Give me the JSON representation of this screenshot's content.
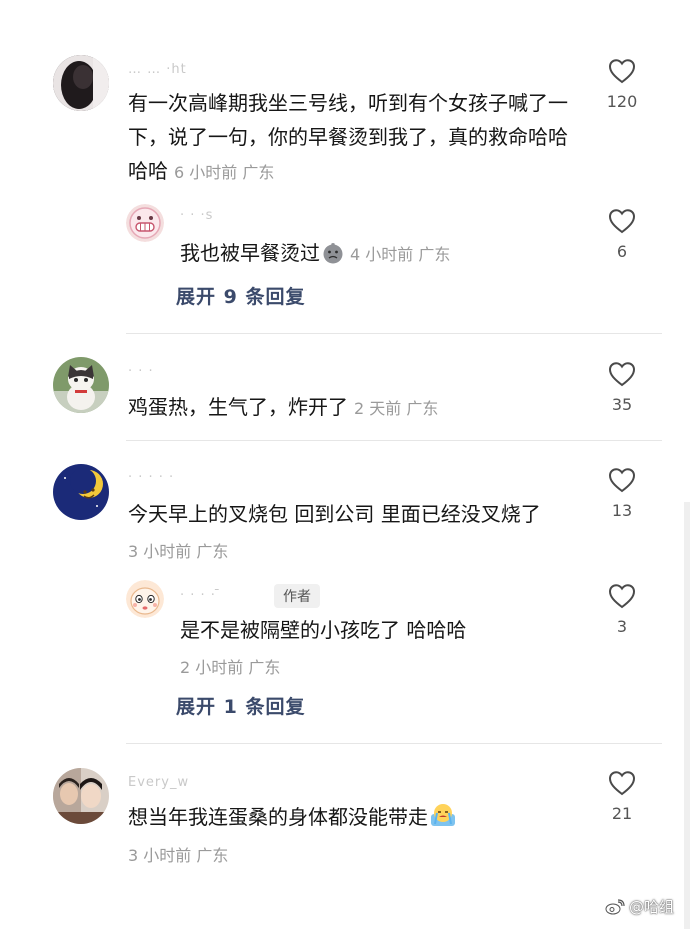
{
  "comments": [
    {
      "username": "… … ·ht",
      "text": "有一次高峰期我坐三号线，听到有个女孩子喊了一下，说了一句，你的早餐烫到我了，真的救命哈哈哈哈",
      "meta": "6 小时前 广东",
      "likes": "120",
      "avatar": "dark-portrait-avatar",
      "reply": {
        "username": "· · ·s",
        "text": "我也被早餐烫过",
        "emoji": "crying-face-emoji",
        "meta": "4 小时前 广东",
        "likes": "6",
        "avatar": "pink-grinning-face-avatar"
      },
      "expand_label": "展开 9 条回复"
    },
    {
      "username": "·  ·  ·",
      "text": "鸡蛋热，生气了，炸开了",
      "meta": "2 天前 广东",
      "likes": "35",
      "avatar": "cat-photo-avatar"
    },
    {
      "username": "· · · · ·",
      "text": "今天早上的叉烧包 回到公司 里面已经没叉烧了",
      "meta": "3 小时前 广东",
      "likes": "13",
      "avatar": "moon-face-avatar",
      "reply": {
        "username": "· · · ·  ̄",
        "author_tag": "作者",
        "text": "是不是被隔壁的小孩吃了 哈哈哈",
        "meta": "2 小时前 广东",
        "likes": "3",
        "avatar": "cartoon-face-avatar"
      },
      "expand_label": "展开 1 条回复"
    },
    {
      "username": "Every_w",
      "text": "想当年我连蛋桑的身体都没能带走",
      "emoji": "crying-emoji",
      "meta": "3 小时前 广东",
      "likes": "21",
      "avatar": "couple-photo-avatar"
    }
  ],
  "watermark": "@哈组",
  "colors": {
    "text": "#161616",
    "meta": "#9a9a9a",
    "expand": "#3b4a6b",
    "divider": "#e6e6e6"
  }
}
